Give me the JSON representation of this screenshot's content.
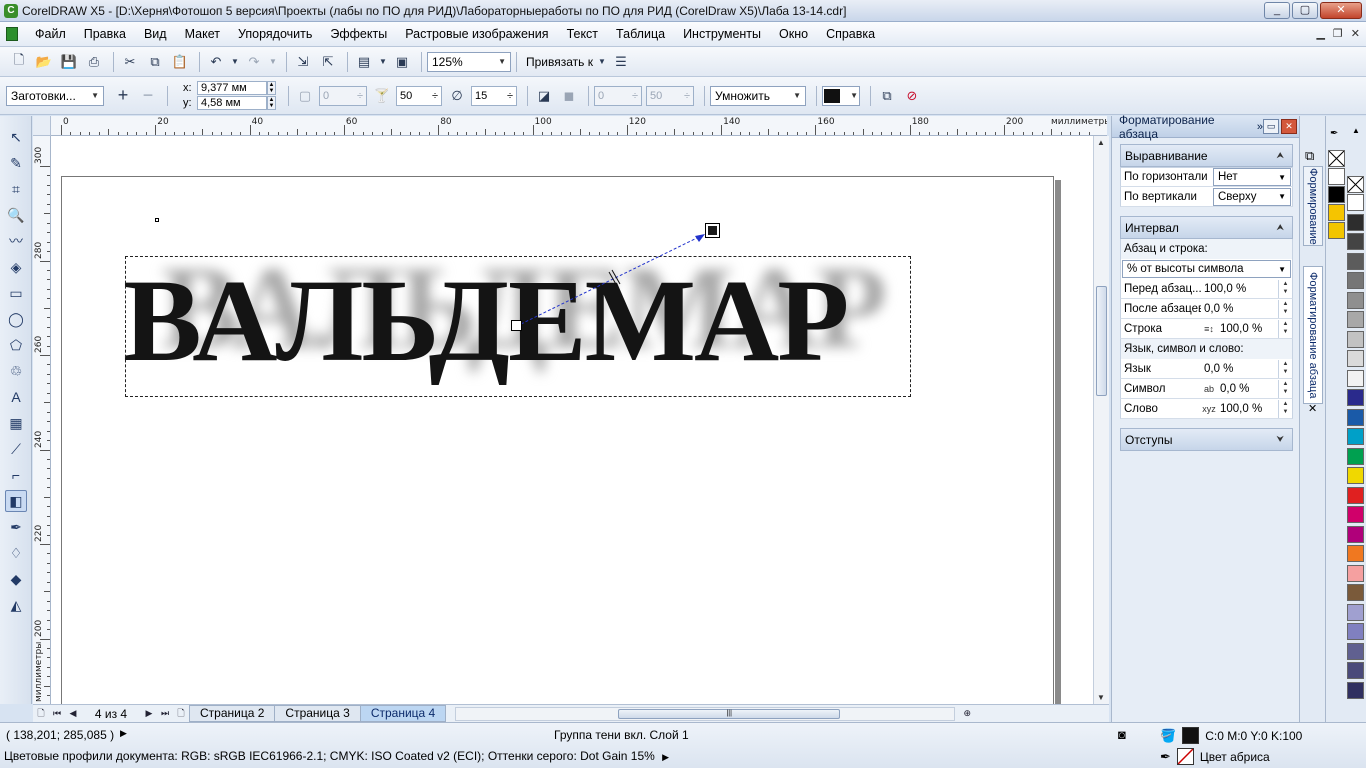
{
  "window": {
    "title": "CorelDRAW X5 - [D:\\Херня\\Фотошоп 5 версия\\Проекты (лабы по ПО для РИД)\\Лабораторныеработы по ПО для РИД (CorelDraw X5)\\Лаба 13-14.cdr]"
  },
  "menu": [
    "Файл",
    "Правка",
    "Вид",
    "Макет",
    "Упорядочить",
    "Эффекты",
    "Растровые изображения",
    "Текст",
    "Таблица",
    "Инструменты",
    "Окно",
    "Справка"
  ],
  "toolbar": {
    "zoom": "125%",
    "snap_label": "Привязать к"
  },
  "propbar": {
    "preset": "Заготовки...",
    "x_label": "x:",
    "x_value": "9,377 мм",
    "y_label": "y:",
    "y_value": "4,58 мм",
    "offset_value": "0",
    "opacity_value": "50",
    "feather_value": "15",
    "stretch_value": "0",
    "fade_value": "50",
    "mode": "Умножить"
  },
  "ruler": {
    "h_labels": [
      "0",
      "20",
      "40",
      "60",
      "80",
      "100",
      "120",
      "140",
      "160",
      "180",
      "200"
    ],
    "h_unit": "миллиметры",
    "v_labels": [
      "300",
      "280",
      "260",
      "240",
      "220",
      "200"
    ],
    "v_unit": "миллиметры"
  },
  "canvas": {
    "text": "ВАЛЬДЕМАР"
  },
  "pagebar": {
    "count": "4 из 4",
    "tabs": [
      "Страница 2",
      "Страница 3",
      "Страница 4"
    ],
    "active_tab": "Страница 4"
  },
  "docker": {
    "title": "Форматирование абзаца",
    "align_section": "Выравнивание",
    "horiz_label": "По горизонтали",
    "horiz_value": "Нет",
    "vert_label": "По вертикали",
    "vert_value": "Сверху",
    "interval_section": "Интервал",
    "para_line_label": "Абзац и строка:",
    "para_line_mode": "% от высоты символа",
    "before_label": "Перед абзац...",
    "before_value": "100,0 %",
    "after_label": "После абзацев",
    "after_value": "0,0 %",
    "line_label": "Строка",
    "line_value": "100,0 %",
    "lang_sub_label": "Язык, символ и слово:",
    "lang_label": "Язык",
    "lang_value": "0,0 %",
    "char_label": "Символ",
    "char_value": "0,0 %",
    "word_label": "Слово",
    "word_value": "100,0 %",
    "indents_section": "Отступы",
    "side_tab1": "Формирование",
    "side_tab2": "Форматирование абзаца"
  },
  "palette": {
    "colors": [
      "#ffffff",
      "#000000",
      "#f5c400",
      "#f2c500"
    ],
    "right_colors": [
      "#ffffff",
      "#2d2d2d",
      "#444444",
      "#5c5c5c",
      "#767676",
      "#8f8f8f",
      "#a8a8a8",
      "#c2c2c2",
      "#dadada",
      "#f2f2f2",
      "#2a2a8c",
      "#1a5aa8",
      "#00a0c8",
      "#00a050",
      "#f0d800",
      "#e02020",
      "#d0006a",
      "#b0007a",
      "#f07820",
      "#f5a0a0",
      "#7a5a3a",
      "#a0a0d0",
      "#8080c0",
      "#606090",
      "#4a4a7a",
      "#303060"
    ]
  },
  "status": {
    "coords": "( 138,201; 285,085 )",
    "object_info": "Группа тени  вкл. Слой 1",
    "profiles": "Цветовые профили документа: RGB: sRGB IEC61966-2.1; CMYK: ISO Coated v2 (ECI); Оттенки серого: Dot Gain 15%",
    "fill": "C:0 M:0 Y:0 K:100",
    "outline": "Цвет абриса"
  }
}
